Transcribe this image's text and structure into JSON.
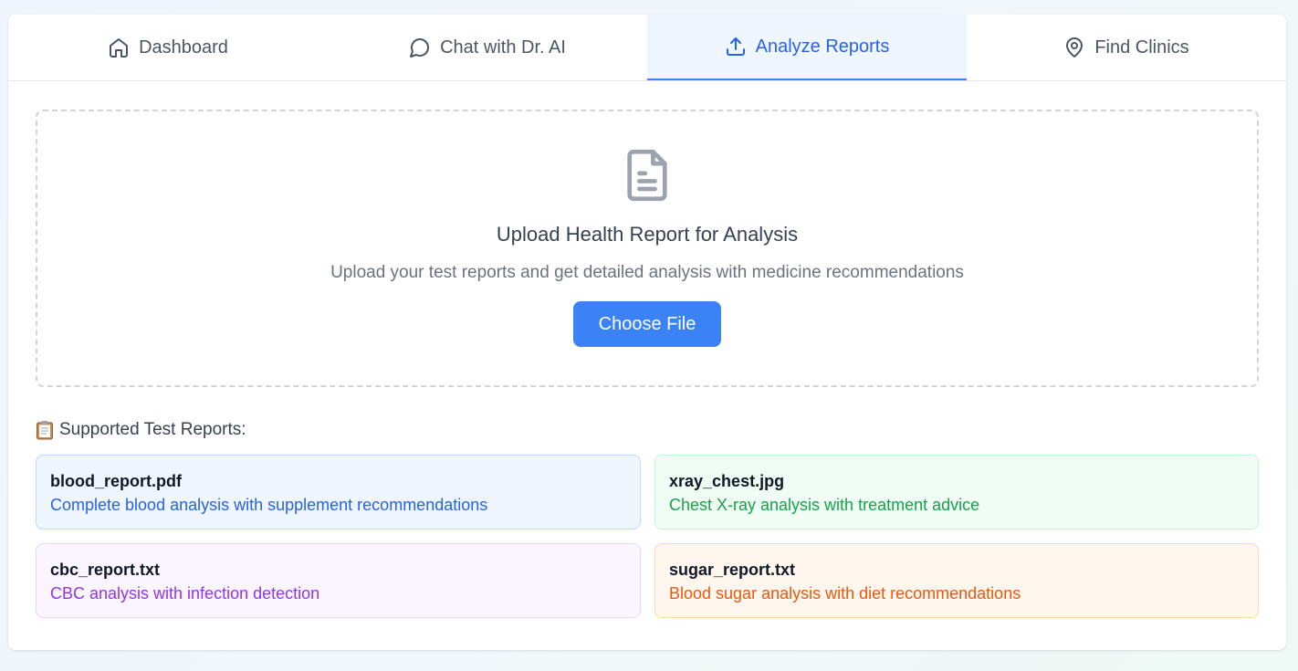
{
  "tabs": [
    {
      "label": "Dashboard",
      "icon": "home-icon"
    },
    {
      "label": "Chat with Dr. AI",
      "icon": "message-icon"
    },
    {
      "label": "Analyze Reports",
      "icon": "upload-icon"
    },
    {
      "label": "Find Clinics",
      "icon": "map-pin-icon"
    }
  ],
  "active_tab": "Analyze Reports",
  "upload": {
    "icon": "file-text-icon",
    "title": "Upload Health Report for Analysis",
    "subtitle": "Upload your test reports and get detailed analysis with medicine recommendations",
    "button_label": "Choose File"
  },
  "supported": {
    "icon": "clipboard-icon",
    "heading": "Supported Test Reports:",
    "reports": [
      {
        "name": "blood_report.pdf",
        "description": "Complete blood analysis with supplement recommendations",
        "color": "#2563eb"
      },
      {
        "name": "xray_chest.jpg",
        "description": "Chest X-ray analysis with treatment advice",
        "color": "#16a34a"
      },
      {
        "name": "cbc_report.txt",
        "description": "CBC analysis with infection detection",
        "color": "#9333ea"
      },
      {
        "name": "sugar_report.txt",
        "description": "Blood sugar analysis with diet recommendations",
        "color": "#ea580c"
      }
    ]
  },
  "colors": {
    "accent": "#3b82f6",
    "active_tab_text": "#2563eb",
    "active_tab_bg": "#eff6ff"
  }
}
